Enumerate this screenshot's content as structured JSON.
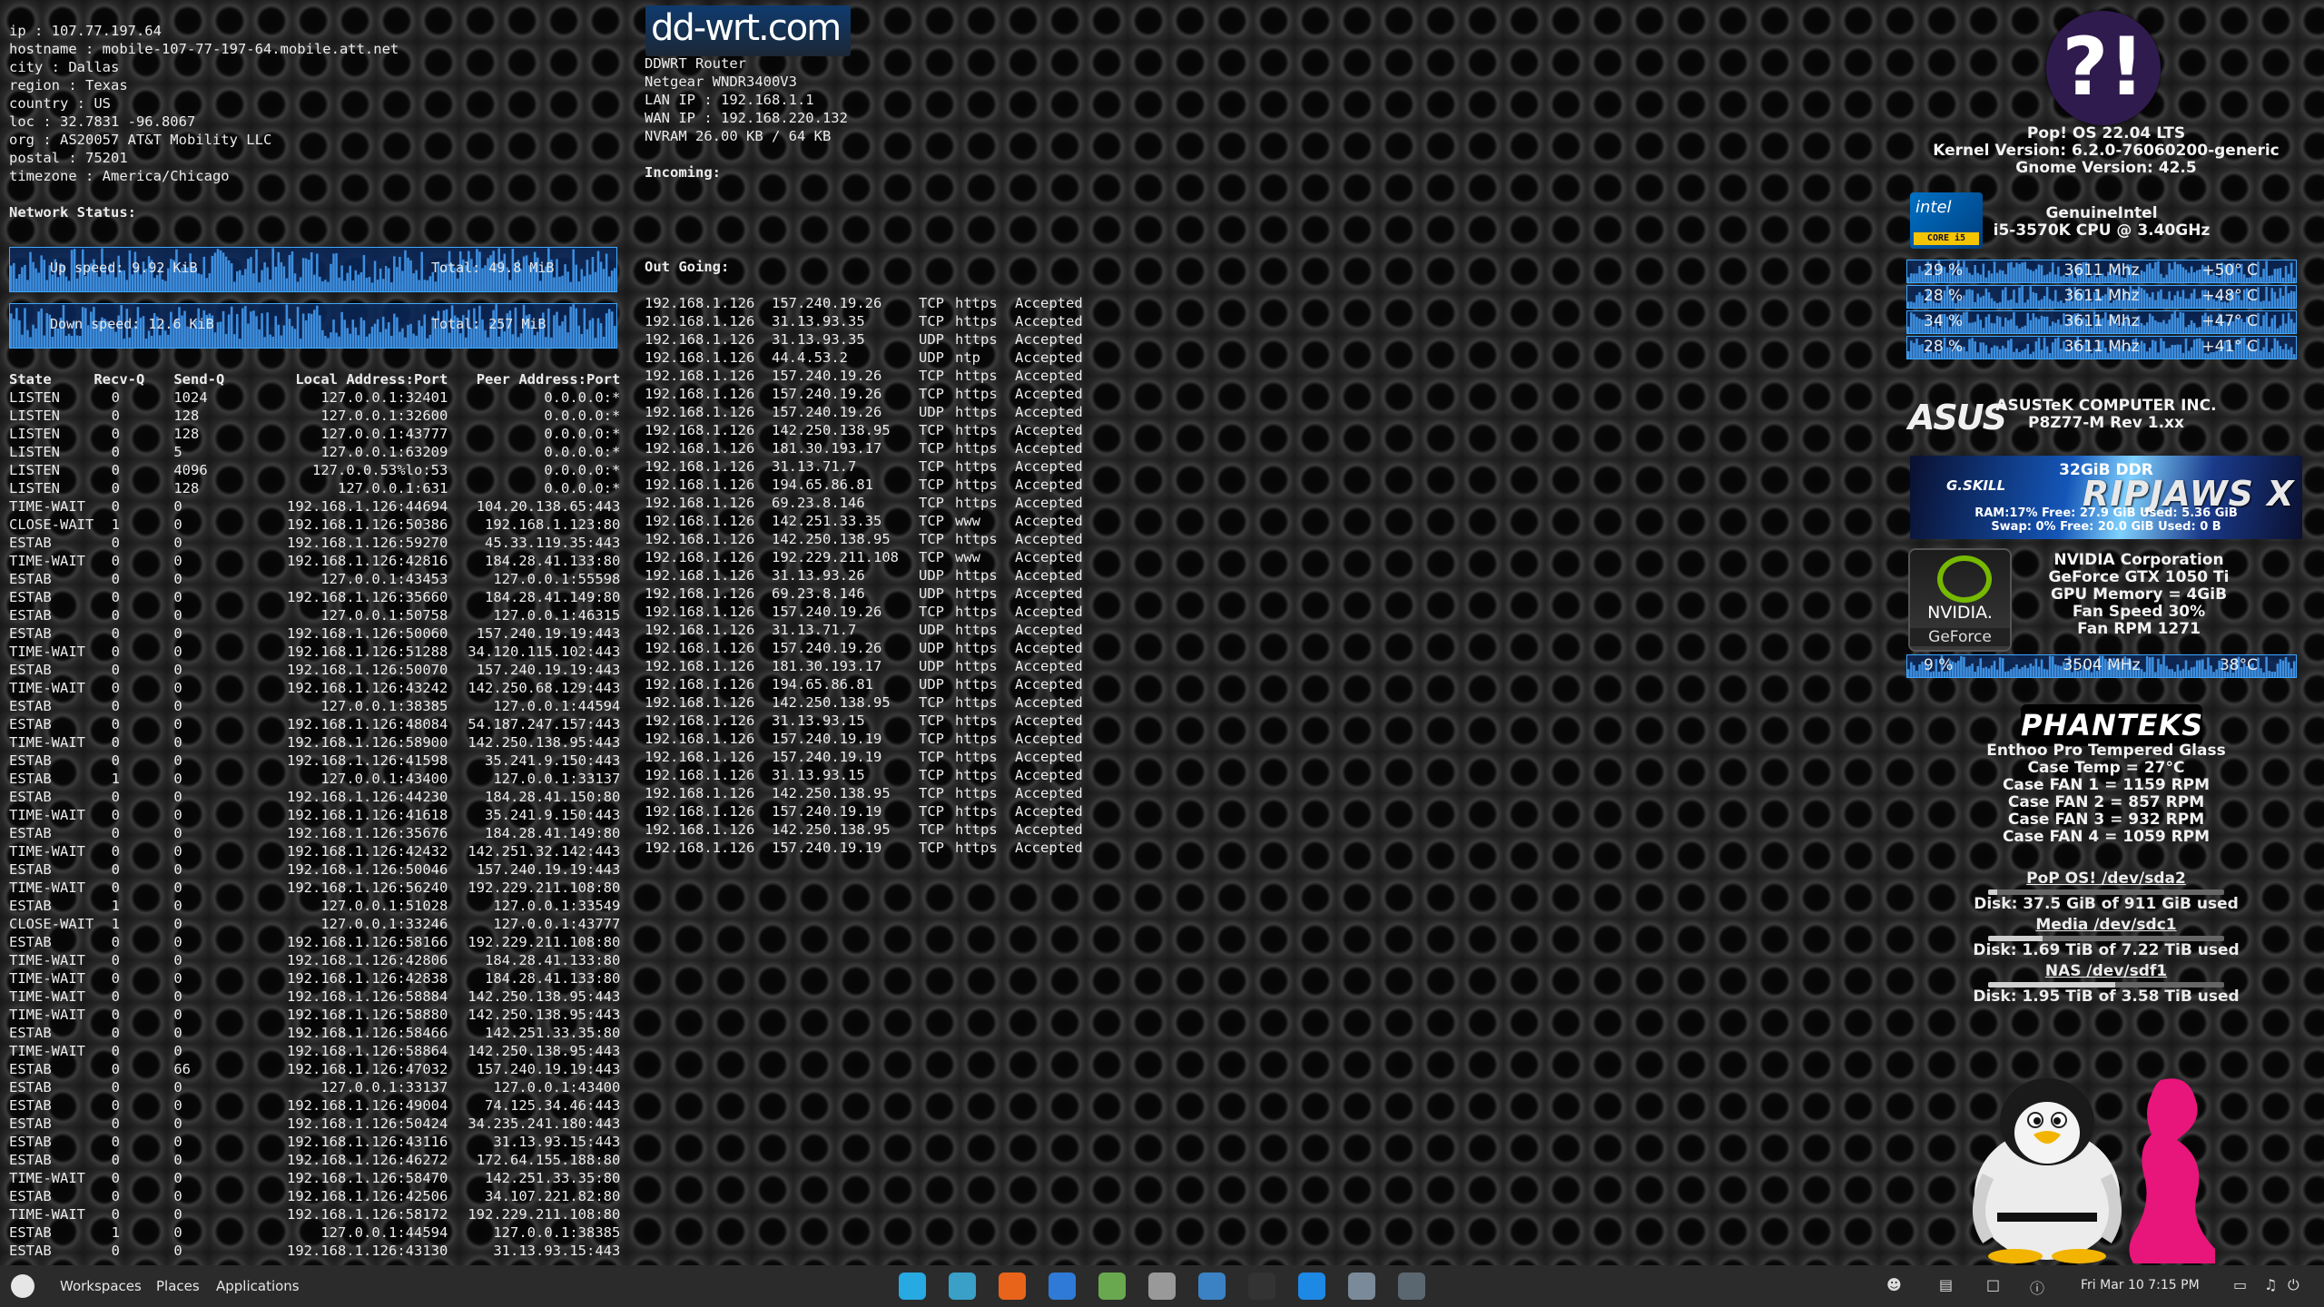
{
  "ipinfo": [
    "ip : 107.77.197.64",
    "hostname : mobile-107-77-197-64.mobile.att.net",
    "city : Dallas",
    "region : Texas",
    "country : US",
    "loc : 32.7831 -96.8067",
    "org : AS20057 AT&T Mobility LLC",
    "postal : 75201",
    "timezone : America/Chicago"
  ],
  "network": {
    "status_label": "Network Status:",
    "up_label": "Up speed: 9.92 KiB",
    "up_total": "Total: 49.8 MiB",
    "down_label": "Down speed: 12.6 KiB",
    "down_total": "Total: 257 MiB"
  },
  "connections": {
    "headers": [
      "State",
      "Recv-Q",
      "Send-Q",
      "Local Address:Port",
      "Peer Address:Port"
    ],
    "rows": [
      [
        "LISTEN",
        "0",
        "1024",
        "127.0.0.1:32401",
        "0.0.0.0:*"
      ],
      [
        "LISTEN",
        "0",
        "128",
        "127.0.0.1:32600",
        "0.0.0.0:*"
      ],
      [
        "LISTEN",
        "0",
        "128",
        "127.0.0.1:43777",
        "0.0.0.0:*"
      ],
      [
        "LISTEN",
        "0",
        "5",
        "127.0.0.1:63209",
        "0.0.0.0:*"
      ],
      [
        "LISTEN",
        "0",
        "4096",
        "127.0.0.53%lo:53",
        "0.0.0.0:*"
      ],
      [
        "LISTEN",
        "0",
        "128",
        "127.0.0.1:631",
        "0.0.0.0:*"
      ],
      [
        "TIME-WAIT",
        "0",
        "0",
        "192.168.1.126:44694",
        "104.20.138.65:443"
      ],
      [
        "CLOSE-WAIT",
        "1",
        "0",
        "192.168.1.126:50386",
        "192.168.1.123:80"
      ],
      [
        "ESTAB",
        "0",
        "0",
        "192.168.1.126:59270",
        "45.33.119.35:443"
      ],
      [
        "TIME-WAIT",
        "0",
        "0",
        "192.168.1.126:42816",
        "184.28.41.133:80"
      ],
      [
        "ESTAB",
        "0",
        "0",
        "127.0.0.1:43453",
        "127.0.0.1:55598"
      ],
      [
        "ESTAB",
        "0",
        "0",
        "192.168.1.126:35660",
        "184.28.41.149:80"
      ],
      [
        "ESTAB",
        "0",
        "0",
        "127.0.0.1:50758",
        "127.0.0.1:46315"
      ],
      [
        "ESTAB",
        "0",
        "0",
        "192.168.1.126:50060",
        "157.240.19.19:443"
      ],
      [
        "TIME-WAIT",
        "0",
        "0",
        "192.168.1.126:51288",
        "34.120.115.102:443"
      ],
      [
        "ESTAB",
        "0",
        "0",
        "192.168.1.126:50070",
        "157.240.19.19:443"
      ],
      [
        "TIME-WAIT",
        "0",
        "0",
        "192.168.1.126:43242",
        "142.250.68.129:443"
      ],
      [
        "ESTAB",
        "0",
        "0",
        "127.0.0.1:38385",
        "127.0.0.1:44594"
      ],
      [
        "ESTAB",
        "0",
        "0",
        "192.168.1.126:48084",
        "54.187.247.157:443"
      ],
      [
        "TIME-WAIT",
        "0",
        "0",
        "192.168.1.126:58900",
        "142.250.138.95:443"
      ],
      [
        "ESTAB",
        "0",
        "0",
        "192.168.1.126:41598",
        "35.241.9.150:443"
      ],
      [
        "ESTAB",
        "1",
        "0",
        "127.0.0.1:43400",
        "127.0.0.1:33137"
      ],
      [
        "ESTAB",
        "0",
        "0",
        "192.168.1.126:44230",
        "184.28.41.150:80"
      ],
      [
        "TIME-WAIT",
        "0",
        "0",
        "192.168.1.126:41618",
        "35.241.9.150:443"
      ],
      [
        "ESTAB",
        "0",
        "0",
        "192.168.1.126:35676",
        "184.28.41.149:80"
      ],
      [
        "TIME-WAIT",
        "0",
        "0",
        "192.168.1.126:42432",
        "142.251.32.142:443"
      ],
      [
        "ESTAB",
        "0",
        "0",
        "192.168.1.126:50046",
        "157.240.19.19:443"
      ],
      [
        "TIME-WAIT",
        "0",
        "0",
        "192.168.1.126:56240",
        "192.229.211.108:80"
      ],
      [
        "ESTAB",
        "1",
        "0",
        "127.0.0.1:51028",
        "127.0.0.1:33549"
      ],
      [
        "CLOSE-WAIT",
        "1",
        "0",
        "127.0.0.1:33246",
        "127.0.0.1:43777"
      ],
      [
        "ESTAB",
        "0",
        "0",
        "192.168.1.126:58166",
        "192.229.211.108:80"
      ],
      [
        "TIME-WAIT",
        "0",
        "0",
        "192.168.1.126:42806",
        "184.28.41.133:80"
      ],
      [
        "TIME-WAIT",
        "0",
        "0",
        "192.168.1.126:42838",
        "184.28.41.133:80"
      ],
      [
        "TIME-WAIT",
        "0",
        "0",
        "192.168.1.126:58884",
        "142.250.138.95:443"
      ],
      [
        "TIME-WAIT",
        "0",
        "0",
        "192.168.1.126:58880",
        "142.250.138.95:443"
      ],
      [
        "ESTAB",
        "0",
        "0",
        "192.168.1.126:58466",
        "142.251.33.35:80"
      ],
      [
        "TIME-WAIT",
        "0",
        "0",
        "192.168.1.126:58864",
        "142.250.138.95:443"
      ],
      [
        "ESTAB",
        "0",
        "66",
        "192.168.1.126:47032",
        "157.240.19.19:443"
      ],
      [
        "ESTAB",
        "0",
        "0",
        "127.0.0.1:33137",
        "127.0.0.1:43400"
      ],
      [
        "ESTAB",
        "0",
        "0",
        "192.168.1.126:49004",
        "74.125.34.46:443"
      ],
      [
        "ESTAB",
        "0",
        "0",
        "192.168.1.126:50424",
        "34.235.241.180:443"
      ],
      [
        "ESTAB",
        "0",
        "0",
        "192.168.1.126:43116",
        "31.13.93.15:443"
      ],
      [
        "ESTAB",
        "0",
        "0",
        "192.168.1.126:46272",
        "172.64.155.188:80"
      ],
      [
        "TIME-WAIT",
        "0",
        "0",
        "192.168.1.126:58470",
        "142.251.33.35:80"
      ],
      [
        "ESTAB",
        "0",
        "0",
        "192.168.1.126:42506",
        "34.107.221.82:80"
      ],
      [
        "TIME-WAIT",
        "0",
        "0",
        "192.168.1.126:58172",
        "192.229.211.108:80"
      ],
      [
        "ESTAB",
        "1",
        "0",
        "127.0.0.1:44594",
        "127.0.0.1:38385"
      ],
      [
        "ESTAB",
        "0",
        "0",
        "192.168.1.126:43130",
        "31.13.93.15:443"
      ]
    ]
  },
  "router": {
    "logo_text": "dd-wrt.com",
    "lines": [
      "DDWRT Router",
      "Netgear WNDR3400V3",
      "LAN IP : 192.168.1.1",
      "WAN IP : 192.168.220.132",
      "NVRAM 26.00 KB / 64 KB"
    ],
    "incoming_label": "Incoming:",
    "outgoing_label": "Out Going:",
    "outgoing": [
      [
        "192.168.1.126",
        "157.240.19.26",
        "TCP",
        "https",
        "Accepted"
      ],
      [
        "192.168.1.126",
        "31.13.93.35",
        "TCP",
        "https",
        "Accepted"
      ],
      [
        "192.168.1.126",
        "31.13.93.35",
        "UDP",
        "https",
        "Accepted"
      ],
      [
        "192.168.1.126",
        "44.4.53.2",
        "UDP",
        "ntp",
        "Accepted"
      ],
      [
        "192.168.1.126",
        "157.240.19.26",
        "TCP",
        "https",
        "Accepted"
      ],
      [
        "192.168.1.126",
        "157.240.19.26",
        "TCP",
        "https",
        "Accepted"
      ],
      [
        "192.168.1.126",
        "157.240.19.26",
        "UDP",
        "https",
        "Accepted"
      ],
      [
        "192.168.1.126",
        "142.250.138.95",
        "TCP",
        "https",
        "Accepted"
      ],
      [
        "192.168.1.126",
        "181.30.193.17",
        "TCP",
        "https",
        "Accepted"
      ],
      [
        "192.168.1.126",
        "31.13.71.7",
        "TCP",
        "https",
        "Accepted"
      ],
      [
        "192.168.1.126",
        "194.65.86.81",
        "TCP",
        "https",
        "Accepted"
      ],
      [
        "192.168.1.126",
        "69.23.8.146",
        "TCP",
        "https",
        "Accepted"
      ],
      [
        "192.168.1.126",
        "142.251.33.35",
        "TCP",
        "www",
        "Accepted"
      ],
      [
        "192.168.1.126",
        "142.250.138.95",
        "TCP",
        "https",
        "Accepted"
      ],
      [
        "192.168.1.126",
        "192.229.211.108",
        "TCP",
        "www",
        "Accepted"
      ],
      [
        "192.168.1.126",
        "31.13.93.26",
        "UDP",
        "https",
        "Accepted"
      ],
      [
        "192.168.1.126",
        "69.23.8.146",
        "UDP",
        "https",
        "Accepted"
      ],
      [
        "192.168.1.126",
        "157.240.19.26",
        "TCP",
        "https",
        "Accepted"
      ],
      [
        "192.168.1.126",
        "31.13.71.7",
        "UDP",
        "https",
        "Accepted"
      ],
      [
        "192.168.1.126",
        "157.240.19.26",
        "UDP",
        "https",
        "Accepted"
      ],
      [
        "192.168.1.126",
        "181.30.193.17",
        "UDP",
        "https",
        "Accepted"
      ],
      [
        "192.168.1.126",
        "194.65.86.81",
        "UDP",
        "https",
        "Accepted"
      ],
      [
        "192.168.1.126",
        "142.250.138.95",
        "TCP",
        "https",
        "Accepted"
      ],
      [
        "192.168.1.126",
        "31.13.93.15",
        "TCP",
        "https",
        "Accepted"
      ],
      [
        "192.168.1.126",
        "157.240.19.19",
        "TCP",
        "https",
        "Accepted"
      ],
      [
        "192.168.1.126",
        "157.240.19.19",
        "TCP",
        "https",
        "Accepted"
      ],
      [
        "192.168.1.126",
        "31.13.93.15",
        "TCP",
        "https",
        "Accepted"
      ],
      [
        "192.168.1.126",
        "142.250.138.95",
        "TCP",
        "https",
        "Accepted"
      ],
      [
        "192.168.1.126",
        "157.240.19.19",
        "TCP",
        "https",
        "Accepted"
      ],
      [
        "192.168.1.126",
        "142.250.138.95",
        "TCP",
        "https",
        "Accepted"
      ],
      [
        "192.168.1.126",
        "157.240.19.19",
        "TCP",
        "https",
        "Accepted"
      ]
    ]
  },
  "system": {
    "os": [
      "Pop! OS 22.04 LTS",
      "Kernel Version: 6.2.0-76060200-generic",
      "Gnome Version: 42.5"
    ],
    "intel_logo_text": "intel",
    "intel_badge": "CORE i5",
    "cpu": [
      "GenuineIntel",
      "i5-3570K CPU @ 3.40GHz"
    ],
    "cores": [
      {
        "usage": "29 %",
        "freq": "3611 Mhz",
        "temp": "+50° C"
      },
      {
        "usage": "28 %",
        "freq": "3611 Mhz",
        "temp": "+48° C"
      },
      {
        "usage": "34 %",
        "freq": "3611 Mhz",
        "temp": "+47° C"
      },
      {
        "usage": "28 %",
        "freq": "3611 Mhz",
        "temp": "+41° C"
      }
    ],
    "asus_logo_text": "ASUS",
    "mobo": [
      "ASUSTeK COMPUTER INC.",
      "P8Z77-M  Rev 1.xx"
    ],
    "ram": {
      "title": "32GiB DDR",
      "gskill": "G.SKILL",
      "brand": "RIPJAWS X",
      "line1": "RAM:17% Free: 27.9 GiB Used: 5.36 GiB",
      "line2": "Swap: 0% Free: 20.0 GiB Used: 0 B"
    },
    "nvidia_logo_text": "NVIDIA.",
    "nvidia_badge": "GeForce",
    "gpu": [
      "NVIDIA Corporation",
      "GeForce GTX 1050 Ti",
      "GPU Memory = 4GiB",
      "Fan Speed 30%",
      "Fan RPM 1271"
    ],
    "gpu_row": {
      "usage": "9 %",
      "freq": "3504 MHz",
      "temp": "38°C"
    },
    "phanteks_logo_text": "PHANTEKS",
    "case": [
      "Enthoo Pro Tempered Glass",
      "Case Temp = 27°C",
      "Case FAN 1 = 1159 RPM",
      "Case FAN 2 = 857 RPM",
      "Case FAN 3 = 932 RPM",
      "Case FAN 4 = 1059 RPM"
    ],
    "disks": [
      {
        "name": "PoP OS! /dev/sda2",
        "usage": "Disk: 37.5 GiB of 911 GiB used",
        "fraction": 0.04
      },
      {
        "name": "Media /dev/sdc1",
        "usage": "Disk: 1.69 TiB of 7.22 TiB used",
        "fraction": 0.23
      },
      {
        "name": "NAS /dev/sdf1",
        "usage": "Disk: 1.95 TiB of 3.58 TiB used",
        "fraction": 0.54
      }
    ]
  },
  "taskbar": {
    "workspaces": "Workspaces",
    "places": "Places",
    "applications": "Applications",
    "apps": [
      "app-grid-icon",
      "screenshot-icon",
      "firefox-icon",
      "thunderbird-icon",
      "yumex-icon",
      "settings-icon",
      "disk-image-icon",
      "terminal-icon",
      "browser-icon",
      "files-icon",
      "tools-icon"
    ],
    "clock": "Fri Mar 10   7:15 PM"
  }
}
